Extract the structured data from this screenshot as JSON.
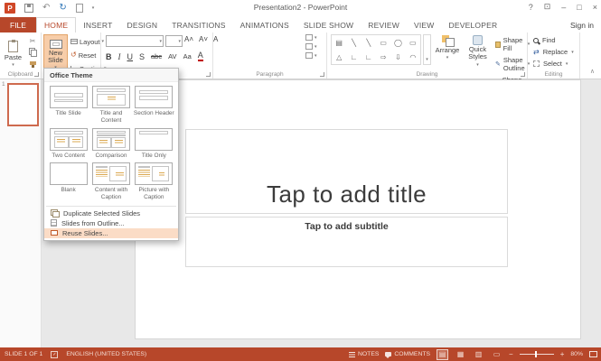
{
  "colors": {
    "accent": "#B7472A",
    "new_slide_pressed": "#F7CDA9",
    "menu_hover": "#FBDCC6",
    "workspace": "#E8E8E8"
  },
  "title_bar": {
    "title": "Presentation2 - PowerPoint",
    "logo_letter": "P",
    "help": "?",
    "minimize": "–",
    "maximize": "□",
    "close": "×"
  },
  "tabs": [
    "FILE",
    "HOME",
    "INSERT",
    "DESIGN",
    "TRANSITIONS",
    "ANIMATIONS",
    "SLIDE SHOW",
    "REVIEW",
    "VIEW",
    "DEVELOPER"
  ],
  "sign_in": "Sign in",
  "ribbon": {
    "paste_label": "Paste",
    "new_slide_label": "New Slide",
    "layout_label": "Layout",
    "reset_label": "Reset",
    "section_label": "Section",
    "font_buttons": [
      "B",
      "I",
      "U",
      "S",
      "abc",
      "AV",
      "Aa",
      "A"
    ],
    "arrange_label": "Arrange",
    "quick_styles_label": "Quick Styles",
    "shape_fill_label": "Shape Fill",
    "shape_outline_label": "Shape Outline",
    "shape_effects_label": "Shape Effects",
    "find_label": "Find",
    "replace_label": "Replace",
    "select_label": "Select",
    "group_labels": {
      "clipboard": "Clipboard",
      "paragraph": "Paragraph",
      "drawing": "Drawing",
      "editing": "Editing"
    }
  },
  "new_slide_menu": {
    "header": "Office Theme",
    "layouts": [
      "Title Slide",
      "Title and Content",
      "Section Header",
      "Two Content",
      "Comparison",
      "Title Only",
      "Blank",
      "Content with Caption",
      "Picture with Caption"
    ],
    "items": [
      "Duplicate Selected Slides",
      "Slides from Outline...",
      "Reuse Slides..."
    ]
  },
  "slides_panel": {
    "slide_number": "1"
  },
  "slide": {
    "title_placeholder": "Tap to add title",
    "subtitle_placeholder": "Tap to add subtitle"
  },
  "status_bar": {
    "slide_info": "SLIDE 1 OF 1",
    "language": "ENGLISH (UNITED STATES)",
    "notes_label": "NOTES",
    "comments_label": "COMMENTS",
    "zoom_level": "80%"
  }
}
